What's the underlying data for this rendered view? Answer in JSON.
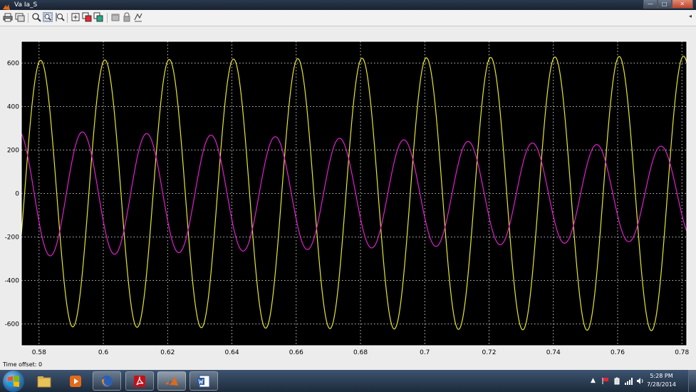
{
  "window": {
    "title": "Va Ia_S",
    "controls": {
      "minimize": "—",
      "maximize": "□",
      "close": "✕"
    }
  },
  "toolbar": {
    "buttons": [
      {
        "name": "print-icon"
      },
      {
        "name": "parameters-icon"
      },
      {
        "name": "zoom-icon"
      },
      {
        "name": "zoom-x-icon"
      },
      {
        "name": "zoom-y-icon"
      },
      {
        "name": "autoscale-icon"
      },
      {
        "name": "save-axes-icon"
      },
      {
        "name": "restore-axes-icon"
      },
      {
        "name": "float-icon"
      },
      {
        "name": "lock-icon"
      },
      {
        "name": "signal-selection-icon"
      }
    ],
    "menu_arrow": "◂"
  },
  "status": {
    "time_offset": "Time offset:  0"
  },
  "colors": {
    "plot_bg": "#000000",
    "axes": "#ffffff",
    "grid": "#ffffff",
    "series1": "#e6e62e",
    "series2": "#e020d0"
  },
  "chart_data": {
    "type": "line",
    "xlim": [
      0.5745,
      0.7815
    ],
    "ylim": [
      -700,
      700
    ],
    "xticks": [
      0.58,
      0.6,
      0.62,
      0.64,
      0.66,
      0.68,
      0.7,
      0.72,
      0.74,
      0.76,
      0.78
    ],
    "xtick_labels": [
      "0.58",
      "0.6",
      "0.62",
      "0.64",
      "0.66",
      "0.68",
      "0.7",
      "0.72",
      "0.74",
      "0.76",
      "0.78"
    ],
    "yticks": [
      600,
      400,
      200,
      0,
      -200,
      -400,
      -600
    ],
    "ytick_labels": [
      "600",
      "400",
      "200",
      "0",
      "-200",
      "-400",
      "-600"
    ],
    "grid": true,
    "series": [
      {
        "color": "#e6e62e",
        "frequency": 50,
        "amplitude_start": 612,
        "amplitude_end": 632,
        "phase_zero_crossing": 0.5755
      },
      {
        "color": "#e020d0",
        "frequency": 50,
        "amplitude_start": 290,
        "amplitude_end": 215,
        "peak_time": 0.5935
      }
    ]
  },
  "taskbar": {
    "clock_time": "5:28 PM",
    "clock_date": "7/28/2014",
    "tray_arrow": "▲",
    "apps": [
      {
        "name": "explorer"
      },
      {
        "name": "media-player"
      },
      {
        "name": "firefox"
      },
      {
        "name": "acrobat"
      },
      {
        "name": "matlab"
      },
      {
        "name": "word"
      }
    ]
  }
}
